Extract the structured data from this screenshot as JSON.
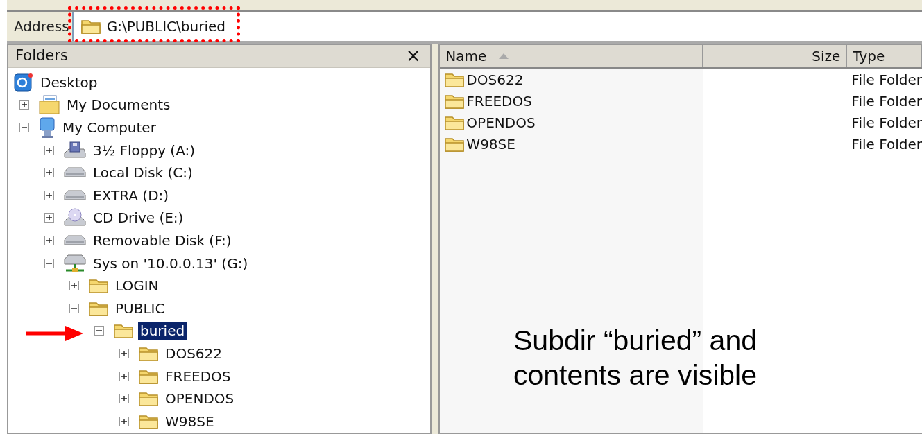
{
  "address": {
    "label": "Address",
    "value": "G:\\PUBLIC\\buried"
  },
  "folders_pane": {
    "title": "Folders",
    "close": "×",
    "tree": [
      {
        "label": "Desktop",
        "kind": "desktop",
        "selected": false,
        "children": [
          {
            "label": "My Documents",
            "kind": "documents",
            "expanded": false,
            "selected": false
          },
          {
            "label": "My Computer",
            "kind": "computer",
            "expanded": true,
            "selected": false,
            "children": [
              {
                "label": "3½ Floppy (A:)",
                "kind": "floppy",
                "expanded": false,
                "selected": false
              },
              {
                "label": "Local Disk (C:)",
                "kind": "disk",
                "expanded": false,
                "selected": false
              },
              {
                "label": "EXTRA (D:)",
                "kind": "disk",
                "expanded": false,
                "selected": false
              },
              {
                "label": "CD Drive (E:)",
                "kind": "cd",
                "expanded": false,
                "selected": false
              },
              {
                "label": "Removable Disk (F:)",
                "kind": "disk",
                "expanded": false,
                "selected": false
              },
              {
                "label": "Sys on '10.0.0.13' (G:)",
                "kind": "network",
                "expanded": true,
                "selected": false,
                "children": [
                  {
                    "label": "LOGIN",
                    "kind": "folder",
                    "expanded": false,
                    "selected": false
                  },
                  {
                    "label": "PUBLIC",
                    "kind": "folder",
                    "expanded": true,
                    "selected": false,
                    "children": [
                      {
                        "label": "buried",
                        "kind": "folder",
                        "expanded": true,
                        "selected": true,
                        "children": [
                          {
                            "label": "DOS622",
                            "kind": "folder",
                            "expanded": false,
                            "selected": false
                          },
                          {
                            "label": "FREEDOS",
                            "kind": "folder",
                            "expanded": false,
                            "selected": false
                          },
                          {
                            "label": "OPENDOS",
                            "kind": "folder",
                            "expanded": false,
                            "selected": false
                          },
                          {
                            "label": "W98SE",
                            "kind": "folder",
                            "expanded": false,
                            "selected": false
                          }
                        ]
                      }
                    ]
                  }
                ]
              }
            ]
          }
        ]
      }
    ]
  },
  "file_list": {
    "columns": [
      {
        "label": "Name",
        "sorted": true
      },
      {
        "label": "Size",
        "sorted": false
      },
      {
        "label": "Type",
        "sorted": false
      }
    ],
    "rows": [
      {
        "name": "DOS622",
        "type": "File Folder"
      },
      {
        "name": "FREEDOS",
        "type": "File Folder"
      },
      {
        "name": "OPENDOS",
        "type": "File Folder"
      },
      {
        "name": "W98SE",
        "type": "File Folder"
      }
    ]
  },
  "annotations": {
    "caption": "Subdir “buried” and contents are visible"
  }
}
